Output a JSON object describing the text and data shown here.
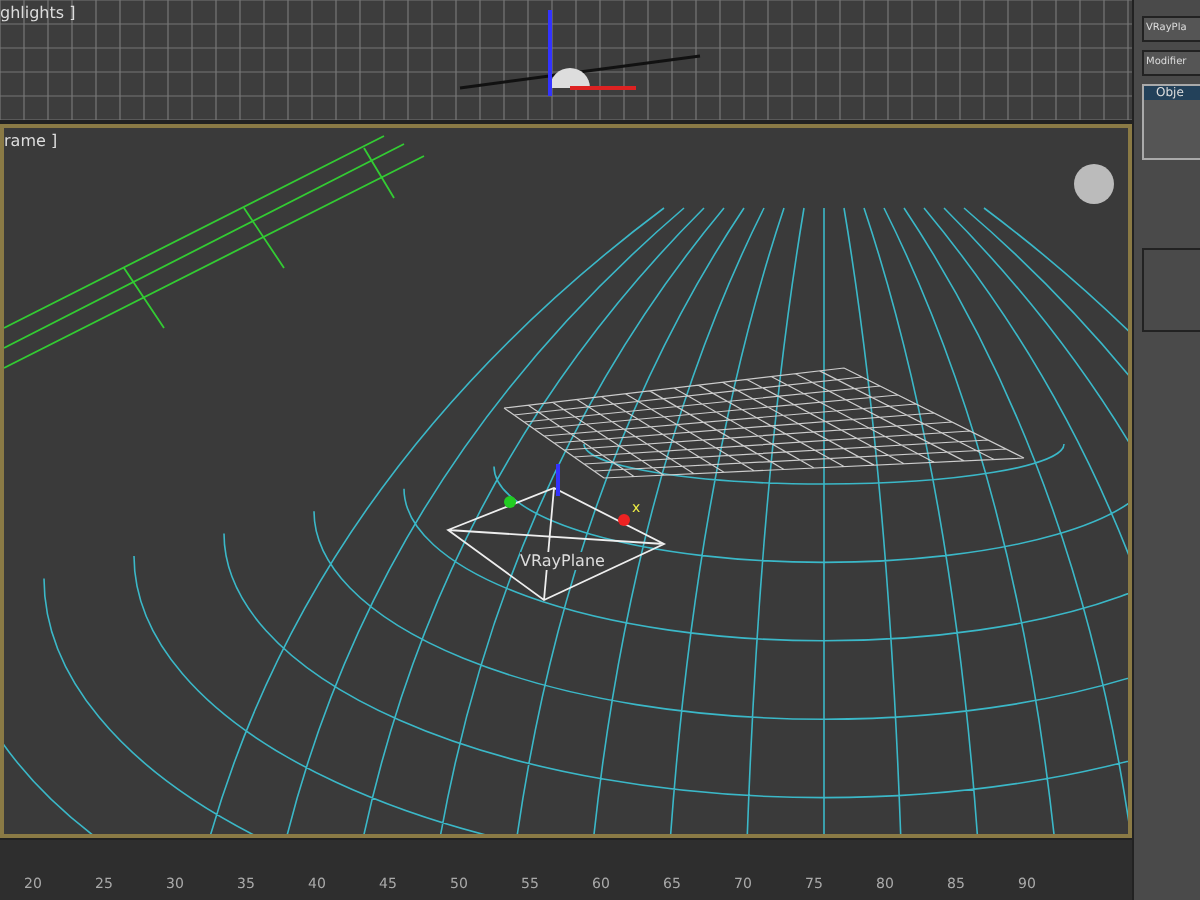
{
  "top_viewport": {
    "label": "ghlights ]"
  },
  "main_viewport": {
    "label": "rame ]",
    "object_label": "VRayPlane",
    "axis_label": "x"
  },
  "command_panel": {
    "name_field": "VRayPla",
    "modifier_list": "Modifier",
    "stack_items": [
      {
        "label": "Obje",
        "selected": true
      }
    ]
  },
  "timeline": {
    "ticks": [
      "20",
      "25",
      "30",
      "35",
      "40",
      "45",
      "50",
      "55",
      "60",
      "65",
      "70",
      "75",
      "80",
      "85",
      "90"
    ]
  }
}
